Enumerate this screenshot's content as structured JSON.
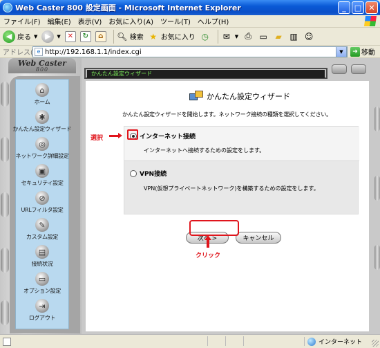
{
  "window": {
    "title": "Web Caster 800 設定画面 - Microsoft Internet Explorer",
    "buttons": {
      "minimize": "_",
      "maximize": "□",
      "close": "✕"
    }
  },
  "menu": [
    "ファイル(F)",
    "編集(E)",
    "表示(V)",
    "お気に入り(A)",
    "ツール(T)",
    "ヘルプ(H)"
  ],
  "toolbar": {
    "back": "戻る",
    "search": "検索",
    "favorites": "お気に入り"
  },
  "address": {
    "label": "アドレス(D)",
    "url": "http://192.168.1.1/index.cgi",
    "go": "移動"
  },
  "logo": {
    "main": "Web Caster",
    "sub": "800"
  },
  "header": {
    "text": "かんたん設定ウィザード"
  },
  "sidebar": {
    "items": [
      {
        "label": "ホーム",
        "icon": "home-icon",
        "glyph": "⌂"
      },
      {
        "label": "かんたん設定ウィザード",
        "icon": "wizard-icon",
        "glyph": "✱"
      },
      {
        "label": "ネットワーク詳細設定",
        "icon": "network-icon",
        "glyph": "◎"
      },
      {
        "label": "セキュリティ設定",
        "icon": "lock-icon",
        "glyph": "▣"
      },
      {
        "label": "URLフィルタ設定",
        "icon": "filter-icon",
        "glyph": "⊘"
      },
      {
        "label": "カスタム設定",
        "icon": "wrench-icon",
        "glyph": "✎"
      },
      {
        "label": "接続状況",
        "icon": "status-icon",
        "glyph": "▤"
      },
      {
        "label": "オプション設定",
        "icon": "options-icon",
        "glyph": "▭"
      },
      {
        "label": "ログアウト",
        "icon": "logout-icon",
        "glyph": "⇥"
      }
    ]
  },
  "main": {
    "title": "かんたん設定ウィザード",
    "description": "かんたん設定ウィザードを開始します。ネットワーク接続の種類を選択してください。",
    "options": [
      {
        "label": "インターネット接続",
        "description": "インターネットへ接続するための設定をします。",
        "selected": true
      },
      {
        "label": "VPN接続",
        "description": "VPN(仮想プライベートネットワーク)を構築するための設定をします。",
        "selected": false
      }
    ],
    "next_button": "次へ >",
    "cancel_button": "キャンセル"
  },
  "annotations": {
    "select": "選択",
    "click": "クリック"
  },
  "status": {
    "zone": "インターネット"
  },
  "colors": {
    "annotation_red": "#e0151c",
    "sidebar_bg": "#b9d9ef",
    "header_text": "#7cf05a"
  }
}
